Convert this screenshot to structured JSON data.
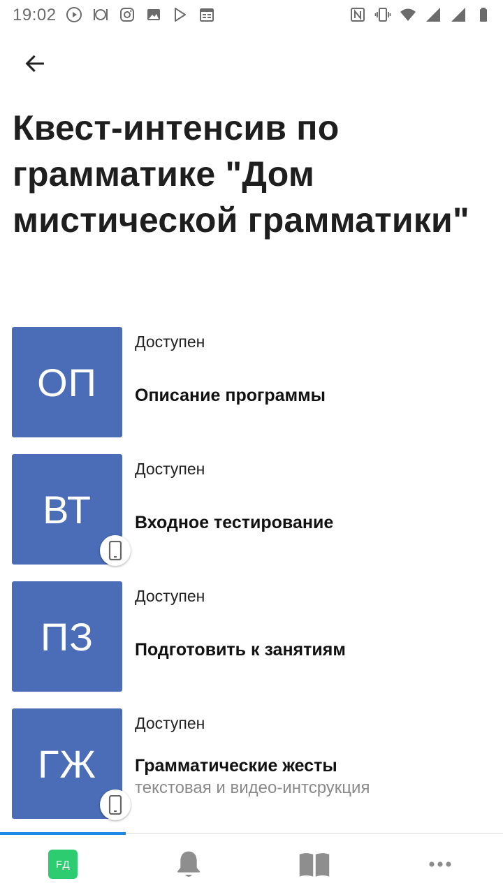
{
  "status_bar": {
    "time": "19:02",
    "left_icons": [
      "play-circle-icon",
      "restaurant-icon",
      "instagram-icon",
      "image-icon",
      "play-store-icon",
      "calendar-icon"
    ],
    "right_icons": [
      "nfc-icon",
      "vibrate-icon",
      "wifi-icon",
      "signal-icon",
      "signal-icon",
      "battery-icon"
    ]
  },
  "header": {
    "back_icon": "arrow-back-icon",
    "title": "Квест-интенсив по грамматике \"Дом мистической грамматики\""
  },
  "lessons": [
    {
      "tile": "ОП",
      "status": "Доступен",
      "title": "Описание программы",
      "subtitle": "",
      "mobile": false
    },
    {
      "tile": "ВТ",
      "status": "Доступен",
      "title": "Входное тестирование",
      "subtitle": "",
      "mobile": true
    },
    {
      "tile": "ПЗ",
      "status": "Доступен",
      "title": "Подготовить к занятиям",
      "subtitle": "",
      "mobile": false
    },
    {
      "tile": "ГЖ",
      "status": "Доступен",
      "title": "Грамматические жесты",
      "subtitle": "текстовая и видео-интсрукция",
      "mobile": true
    }
  ],
  "bottom_nav": {
    "avatar_initials": "FД",
    "items": [
      "profile",
      "notifications-bell-icon",
      "book-icon",
      "more-icon"
    ]
  },
  "colors": {
    "tile": "#4b6cb7",
    "avatar": "#2ecc71",
    "active_indicator": "#1e88e5"
  }
}
